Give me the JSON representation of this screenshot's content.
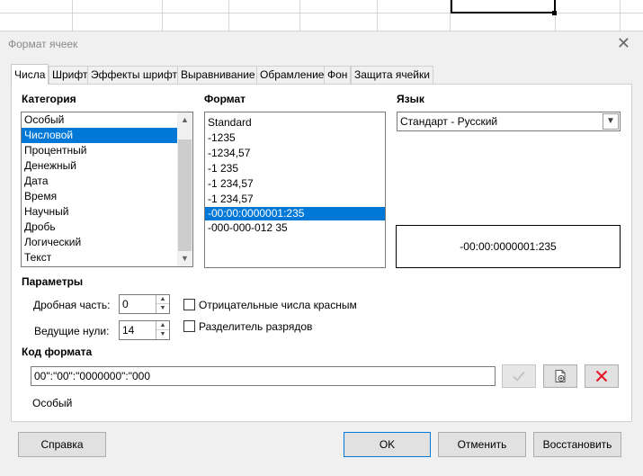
{
  "dialog": {
    "title": "Формат ячеек"
  },
  "tabs": [
    {
      "label": "Числа",
      "active": true
    },
    {
      "label": "Шрифт",
      "active": false
    },
    {
      "label": "Эффекты шрифта",
      "active": false
    },
    {
      "label": "Выравнивание",
      "active": false
    },
    {
      "label": "Обрамление",
      "active": false
    },
    {
      "label": "Фон",
      "active": false
    },
    {
      "label": "Защита ячейки",
      "active": false
    }
  ],
  "category": {
    "heading": "Категория",
    "items": [
      "Особый",
      "Числовой",
      "Процентный",
      "Денежный",
      "Дата",
      "Время",
      "Научный",
      "Дробь",
      "Логический",
      "Текст"
    ],
    "selected": "Числовой"
  },
  "format": {
    "heading": "Формат",
    "items": [
      "Standard",
      "-1235",
      "-1234,57",
      "-1 235",
      "-1 234,57",
      "-1 234,57",
      "-00:00:0000001:235",
      "-000-000-012 35"
    ],
    "selected": "-00:00:0000001:235"
  },
  "language": {
    "heading": "Язык",
    "value": "Стандарт - Русский"
  },
  "preview": {
    "text": "-00:00:0000001:235"
  },
  "params": {
    "heading": "Параметры",
    "decimal_label": "Дробная часть:",
    "decimal_value": "0",
    "leading_label": "Ведущие нули:",
    "leading_value": "14",
    "negative_red_label": "Отрицательные числа красным",
    "negative_red_checked": false,
    "thousands_label": "Разделитель разрядов",
    "thousands_checked": false
  },
  "format_code": {
    "heading": "Код формата",
    "value": "00\":\"00\":\"0000000\":\"000",
    "description": "Особый"
  },
  "icons": {
    "accept": "checkmark-icon",
    "edit_comment": "comment-edit-icon",
    "delete": "delete-x-icon",
    "close": "close-icon",
    "delete_color": "#e81123"
  },
  "buttons": {
    "help": "Справка",
    "ok": "OK",
    "cancel": "Отменить",
    "reset": "Восстановить"
  }
}
